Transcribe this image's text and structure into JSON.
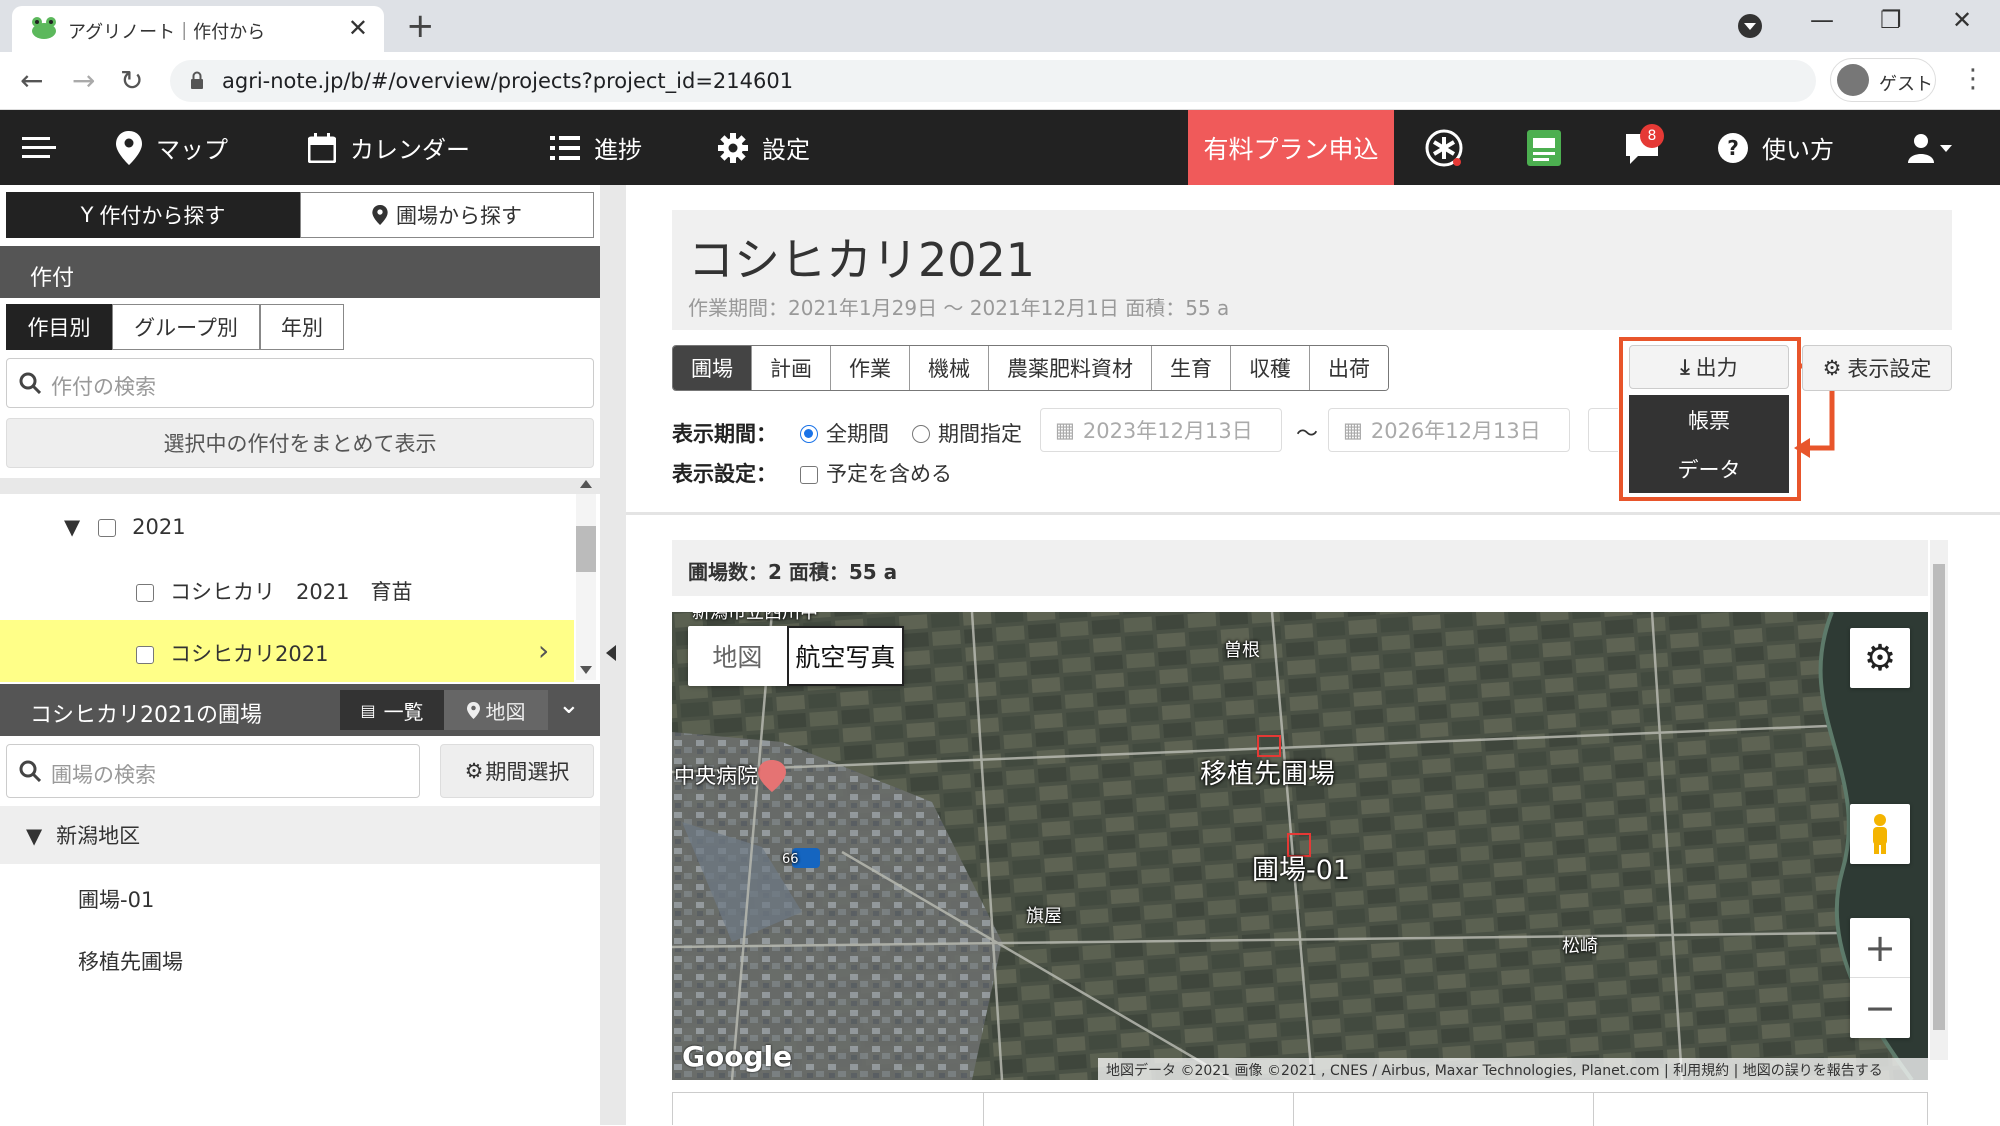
{
  "browser": {
    "tab_title": "アグリノート｜作付から",
    "url": "agri-note.jp/b/#/overview/projects?project_id=214601",
    "profile_label": "ゲスト"
  },
  "app_nav": {
    "map": "マップ",
    "calendar": "カレンダー",
    "progress": "進捗",
    "settings": "設定",
    "paid_plan": "有料プラン申込",
    "notification_count": "8",
    "help": "使い方"
  },
  "sidebar": {
    "search_mode_tabs": [
      "作付から探す",
      "圃場から探す"
    ],
    "crop_section_title": "作付",
    "group_tabs": [
      "作目別",
      "グループ別",
      "年別"
    ],
    "crop_search_placeholder": "作付の検索",
    "show_selected_button": "選択中の作付をまとめて表示",
    "tree": {
      "year": "2021",
      "items": [
        "コシヒカリ　2021　育苗",
        "コシヒカリ2021"
      ]
    },
    "fields_section_title": "コシヒカリ2021の圃場",
    "view_toggle": [
      "一覧",
      "地図"
    ],
    "field_search_placeholder": "圃場の検索",
    "period_button": "期間選択",
    "region": "新潟地区",
    "fields": [
      "圃場-01",
      "移植先圃場"
    ]
  },
  "main": {
    "title": "コシヒカリ2021",
    "subtitle": "作業期間：2021年1月29日 ～ 2021年12月1日  面積：55 a",
    "tabs": [
      "圃場",
      "計画",
      "作業",
      "機械",
      "農薬肥料資材",
      "生育",
      "収穫",
      "出荷"
    ],
    "export_button": "出力",
    "export_menu": [
      "帳票",
      "データ"
    ],
    "display_settings_button": "表示設定",
    "period_label": "表示期間：",
    "radio_all": "全期間",
    "radio_range": "期間指定",
    "date_from": "2023年12月13日",
    "date_to": "2026年12月13日",
    "tilde": "～",
    "display_label": "表示設定：",
    "include_plans": "予定を含める",
    "field_summary": "圃場数：2 面積：55 a",
    "map": {
      "type_toggle": [
        "地図",
        "航空写真"
      ],
      "labels": {
        "field_transplant": "移植先圃場",
        "field_01": "圃場-01",
        "hospital": "中央病院",
        "sone": "曽根",
        "hataya": "旗屋",
        "matsuzaki": "松崎",
        "route": "66",
        "top_cut": "新潟市立西川中"
      },
      "google_logo": "Google",
      "attribution": "地図データ ©2021 画像 ©2021 , CNES / Airbus, Maxar Technologies, Planet.com  |  利用規約  |  地図の誤りを報告する"
    }
  },
  "colors": {
    "nav_bg": "#222222",
    "plan_red": "#f05a5a",
    "highlight_yellow": "#ffff88",
    "annotation_orange": "#e8552b"
  }
}
